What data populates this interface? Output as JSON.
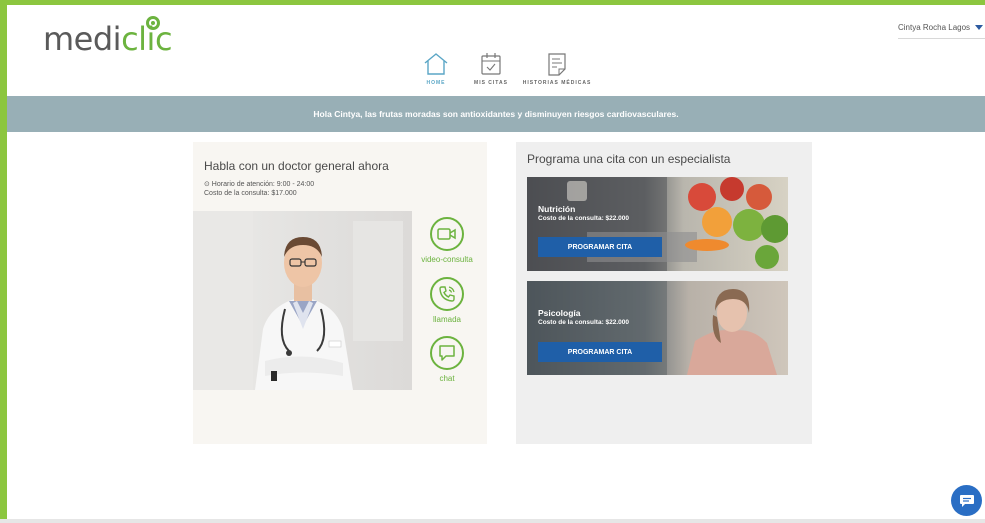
{
  "brand": {
    "logo_part1": "medi",
    "logo_part2": "clic",
    "primary_green": "#6cb33f",
    "blue": "#1f5fa8"
  },
  "user": {
    "name": "Cintya Rocha Lagos"
  },
  "nav": {
    "items": [
      {
        "label": "HOME",
        "icon": "home-icon",
        "active": true
      },
      {
        "label": "MIS CITAS",
        "icon": "calendar-icon",
        "active": false
      },
      {
        "label": "HISTORIAS MÉDICAS",
        "icon": "document-icon",
        "active": false
      }
    ]
  },
  "banner": {
    "text": "Hola Cintya, las frutas moradas son antioxidantes y disminuyen riesgos cardiovasculares."
  },
  "doctor_card": {
    "title": "Habla con un doctor general ahora",
    "hours": "⊙ Horario de atención: 9:00 - 24:00",
    "cost": "Costo de la consulta: $17.000",
    "options": [
      {
        "label": "video-consulta",
        "icon": "video-camera-icon"
      },
      {
        "label": "llamada",
        "icon": "phone-icon"
      },
      {
        "label": "chat",
        "icon": "chat-bubble-icon"
      }
    ]
  },
  "specialist_card": {
    "title": "Programa una cita con un especialista",
    "specialties": [
      {
        "name": "Nutrición",
        "cost": "Costo de la consulta: $22.000",
        "button": "PROGRAMAR CITA"
      },
      {
        "name": "Psicología",
        "cost": "Costo de la consulta: $22.000",
        "button": "PROGRAMAR CITA"
      }
    ]
  },
  "chat_fab": {
    "icon": "chat-icon"
  }
}
